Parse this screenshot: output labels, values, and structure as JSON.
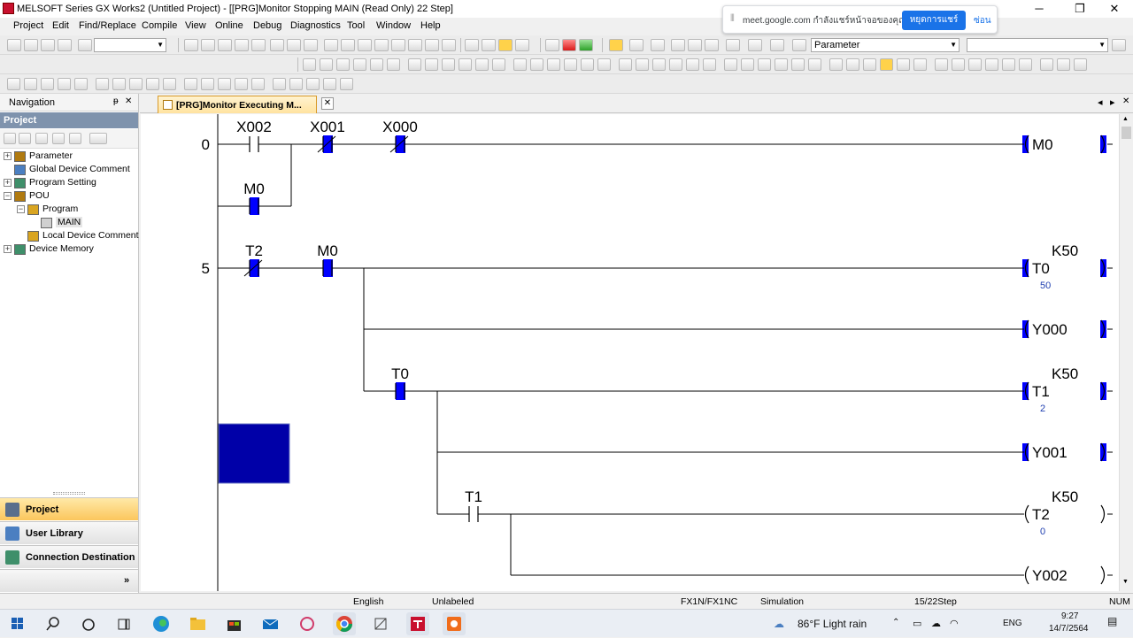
{
  "window": {
    "title": "MELSOFT Series GX Works2 (Untitled Project) - [[PRG]Monitor Stopping MAIN (Read Only) 22 Step]",
    "controls": {
      "minimize": "─",
      "maximize": "❐",
      "close": "✕"
    }
  },
  "menu": [
    "Project",
    "Edit",
    "Find/Replace",
    "Compile",
    "View",
    "Online",
    "Debug",
    "Diagnostics",
    "Tool",
    "Window",
    "Help"
  ],
  "toolbar": {
    "parameter_combo": "Parameter"
  },
  "meet_banner": {
    "message": "meet.google.com กำลังแชร์หน้าจอของคุณ",
    "stop_label": "หยุดการแชร์",
    "hide_label": "ซ่อน"
  },
  "navigation": {
    "title": "Navigation",
    "pin": "ᵽ",
    "close": "✕",
    "section": "Project",
    "tree": [
      {
        "label": "Parameter",
        "level": 0,
        "expander": "+"
      },
      {
        "label": "Global Device Comment",
        "level": 0,
        "expander": ""
      },
      {
        "label": "Program Setting",
        "level": 0,
        "expander": "+"
      },
      {
        "label": "POU",
        "level": 0,
        "expander": "−"
      },
      {
        "label": "Program",
        "level": 1,
        "expander": "−"
      },
      {
        "label": "MAIN",
        "level": 2,
        "expander": ""
      },
      {
        "label": "Local Device Comment",
        "level": 1,
        "expander": ""
      },
      {
        "label": "Device Memory",
        "level": 0,
        "expander": "+"
      }
    ],
    "bottom_buttons": [
      "Project",
      "User Library",
      "Connection Destination"
    ],
    "more": "»"
  },
  "editor": {
    "tab_label": "[PRG]Monitor Executing M...",
    "tab_close": "✕",
    "nav_arrows": {
      "left": "◂",
      "right": "▸",
      "close": "✕"
    },
    "ladder": {
      "step_numbers": [
        "0",
        "5"
      ],
      "contacts": [
        {
          "label": "X002"
        },
        {
          "label": "X001"
        },
        {
          "label": "X000"
        },
        {
          "label": "M0"
        },
        {
          "label": "T2"
        },
        {
          "label": "M0"
        },
        {
          "label": "T0"
        },
        {
          "label": "T1"
        }
      ],
      "coils": [
        {
          "label": "M0",
          "setting": "",
          "value": ""
        },
        {
          "label": "T0",
          "setting": "K50",
          "value": "50"
        },
        {
          "label": "Y000",
          "setting": "",
          "value": ""
        },
        {
          "label": "T1",
          "setting": "K50",
          "value": "2"
        },
        {
          "label": "Y001",
          "setting": "",
          "value": ""
        },
        {
          "label": "T2",
          "setting": "K50",
          "value": "0"
        },
        {
          "label": "Y002",
          "setting": "",
          "value": ""
        }
      ]
    }
  },
  "status": {
    "language": "English",
    "label_mode": "Unlabeled",
    "cpu": "FX1N/FX1NC",
    "mode": "Simulation",
    "step": "15/22Step",
    "num": "NUM"
  },
  "taskbar": {
    "weather": "86°F  Light rain",
    "lang": "ENG",
    "time": "9:27",
    "date": "14/7/2564"
  },
  "colors": {
    "monitor_on": "#0000ff",
    "selection": "#0000a8",
    "tab_active": "#ffe3a0"
  }
}
